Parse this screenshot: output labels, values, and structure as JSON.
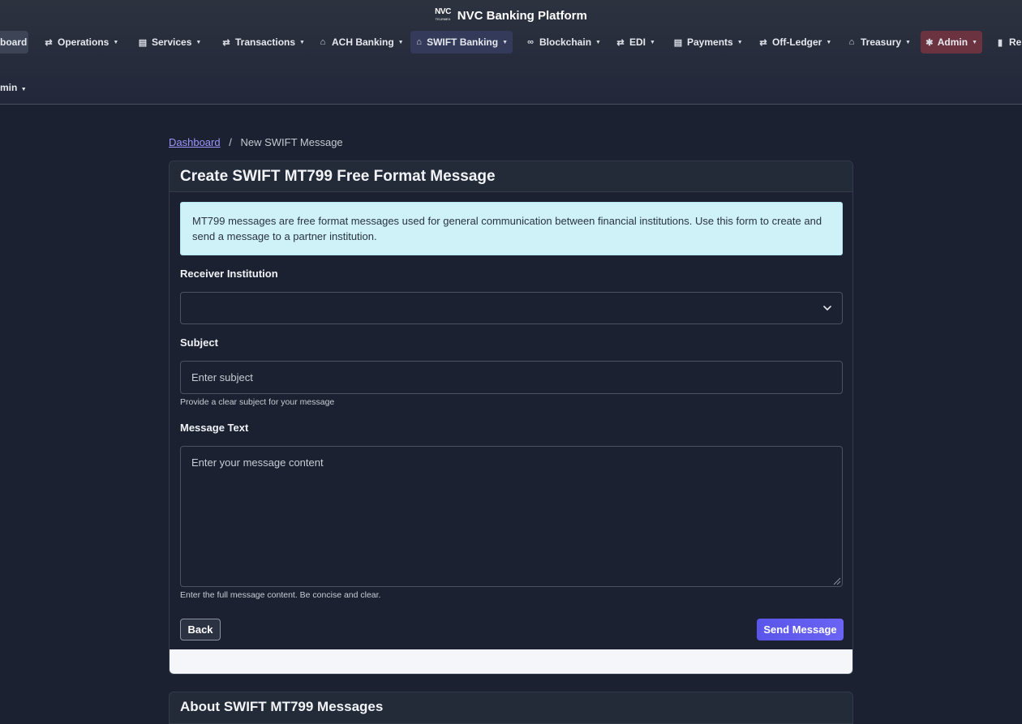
{
  "brand": {
    "logo_text": "NVC",
    "logo_subtext": "TELEMEX",
    "name": "NVC Banking Platform"
  },
  "nav": {
    "items": [
      {
        "label": "board",
        "icon": "dashboard-icon"
      },
      {
        "label": "Operations",
        "icon": "exchange-arrows-icon"
      },
      {
        "label": "Services",
        "icon": "id-card-icon"
      },
      {
        "label": "Transactions",
        "icon": "exchange-arrows-icon"
      },
      {
        "label": "ACH Banking",
        "icon": "bank-icon"
      },
      {
        "label": "SWIFT Banking",
        "icon": "bank-icon"
      },
      {
        "label": "Blockchain",
        "icon": "link-icon"
      },
      {
        "label": "EDI",
        "icon": "exchange-arrows-icon"
      },
      {
        "label": "Payments",
        "icon": "id-card-icon"
      },
      {
        "label": "Off-Ledger",
        "icon": "exchange-arrows-icon"
      },
      {
        "label": "Treasury",
        "icon": "bank-icon"
      },
      {
        "label": "Admin",
        "icon": "gear-icon"
      },
      {
        "label": "Res",
        "icon": "book-icon"
      }
    ],
    "second_row_label": "min"
  },
  "breadcrumb": {
    "home": "Dashboard",
    "separator": "/",
    "current": "New SWIFT Message"
  },
  "form": {
    "title": "Create SWIFT MT799 Free Format Message",
    "info": "MT799 messages are free format messages used for general communication between financial institutions. Use this form to create and send a message to a partner institution.",
    "receiver_label": "Receiver Institution",
    "receiver_value": "",
    "subject_label": "Subject",
    "subject_placeholder": "Enter subject",
    "subject_help": "Provide a clear subject for your message",
    "message_label": "Message Text",
    "message_placeholder": "Enter your message content",
    "message_help": "Enter the full message content. Be concise and clear.",
    "back_label": "Back",
    "send_label": "Send Message"
  },
  "about": {
    "title": "About SWIFT MT799 Messages"
  },
  "colors": {
    "background": "#1b2130",
    "accent": "#5a56ea",
    "link": "#9a95ff",
    "info_bg": "#cff1f8",
    "admin_bg": "#6b3340"
  }
}
